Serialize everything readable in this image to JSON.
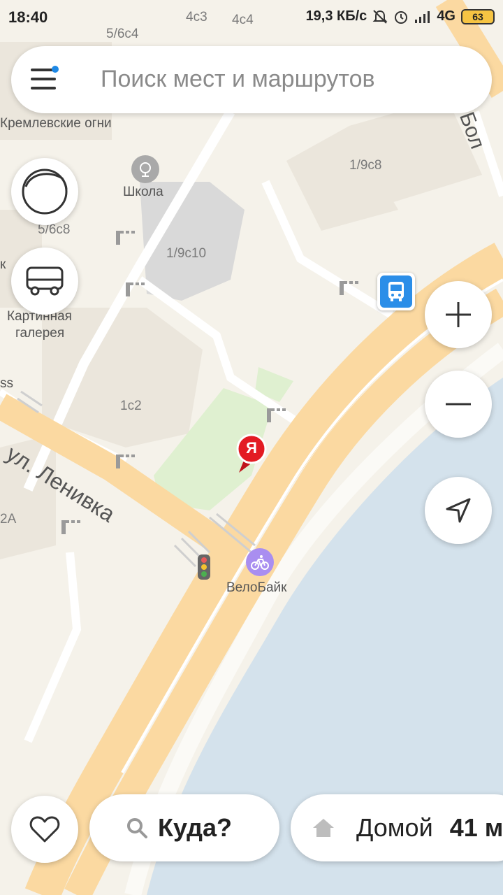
{
  "status_bar": {
    "time": "18:40",
    "network_speed": "19,3 КБ/с",
    "network_type": "4G",
    "battery": "63"
  },
  "search": {
    "placeholder": "Поиск мест и маршрутов"
  },
  "map": {
    "labels": {
      "label_4c3": "4с3",
      "label_4c4": "4с4",
      "label_56c4": "5/6с4",
      "kremlevskie": "Кремлевские огни",
      "school": "Школа",
      "label_19c8": "1/9с8",
      "label_56c8": "5/6с8",
      "label_19c10": "1/9с10",
      "kartinnaya": "Картинная",
      "galereya": "галерея",
      "label_1c2": "1с2",
      "street": "ул. Ленивка",
      "label_2a": "2А",
      "velobike": "ВелоБайк",
      "bol": "Бол",
      "ss": "ss",
      "k": "к"
    },
    "user_marker_letter": "Я"
  },
  "controls": {
    "zoom_in": "+",
    "zoom_out": "−"
  },
  "bottom": {
    "where_label": "Куда?",
    "home_label": "Домой",
    "home_time": "41 м"
  },
  "colors": {
    "road": "#fbd9a1",
    "water": "#d4e2ec",
    "park": "#dff0d0",
    "building": "#ebe6dc",
    "transport_blue": "#2b8ee8",
    "yandex_red": "#e31b23",
    "bike_purple": "#a98ef0"
  }
}
